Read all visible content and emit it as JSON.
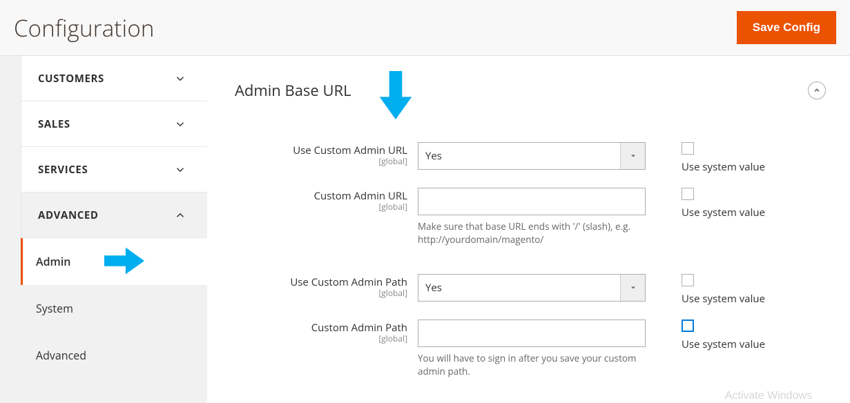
{
  "header": {
    "title": "Configuration",
    "save_label": "Save Config"
  },
  "sidebar": {
    "groups": [
      {
        "label": "CUSTOMERS",
        "expanded": false
      },
      {
        "label": "SALES",
        "expanded": false
      },
      {
        "label": "SERVICES",
        "expanded": false
      },
      {
        "label": "ADVANCED",
        "expanded": true
      }
    ],
    "advanced_items": [
      {
        "label": "Admin",
        "active": true
      },
      {
        "label": "System",
        "active": false
      },
      {
        "label": "Advanced",
        "active": false
      }
    ]
  },
  "section": {
    "title": "Admin Base URL",
    "scope_label": "[global]",
    "use_system_label": "Use system value",
    "fields": {
      "use_custom_admin_url": {
        "label": "Use Custom Admin URL",
        "value": "Yes"
      },
      "custom_admin_url": {
        "label": "Custom Admin URL",
        "value": "",
        "hint": "Make sure that base URL ends with '/' (slash), e.g. http://yourdomain/magento/"
      },
      "use_custom_admin_path": {
        "label": "Use Custom Admin Path",
        "value": "Yes"
      },
      "custom_admin_path": {
        "label": "Custom Admin Path",
        "value": "",
        "hint": "You will have to sign in after you save your custom admin path."
      }
    }
  },
  "watermark": "Activate Windows"
}
